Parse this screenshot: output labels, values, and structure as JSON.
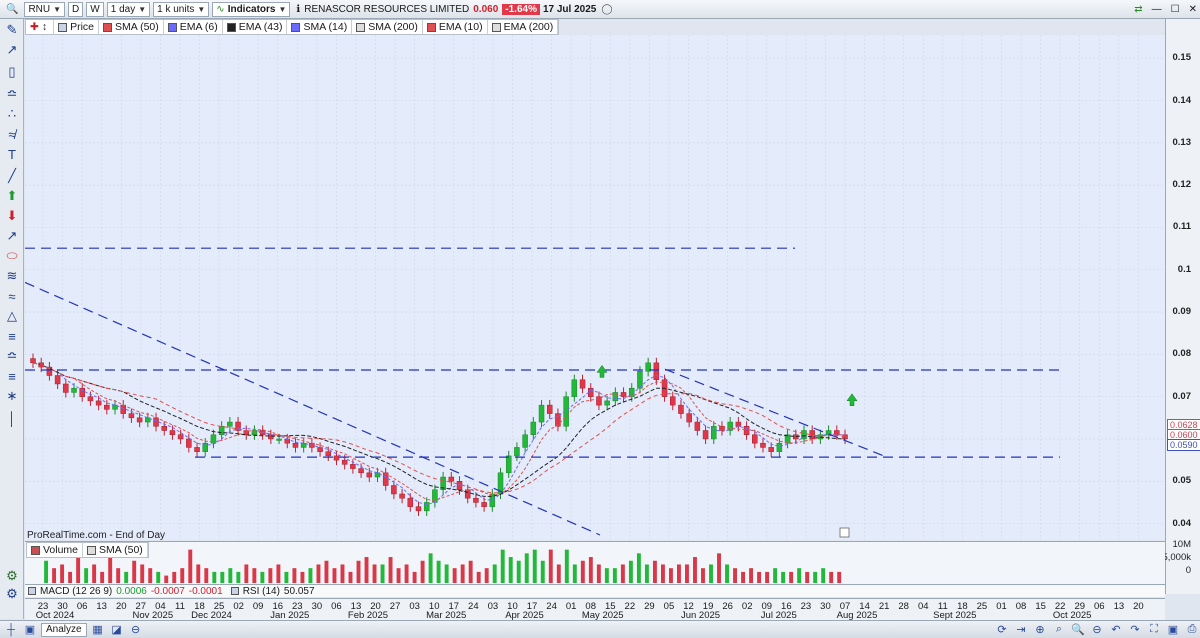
{
  "toolbar": {
    "symbol": "RNU",
    "d_btn": "D",
    "w_btn": "W",
    "period": "1 day",
    "units": "1 k units",
    "indicators": "Indicators",
    "instrument": "RENASCOR RESOURCES LIMITED",
    "last_price": "0.060",
    "change": "-1.64%",
    "date": "17 Jul 2025"
  },
  "legend": [
    {
      "label": "Price",
      "color": "#c8d4e6"
    },
    {
      "label": "SMA (50)",
      "color": "#e05050"
    },
    {
      "label": "EMA (6)",
      "color": "#6a6aff"
    },
    {
      "label": "EMA (43)",
      "color": "#222222"
    },
    {
      "label": "SMA (14)",
      "color": "#6a6aff"
    },
    {
      "label": "SMA (200)",
      "color": "#dddddd"
    },
    {
      "label": "EMA (10)",
      "color": "#e05050"
    },
    {
      "label": "EMA (200)",
      "color": "#dddddd"
    }
  ],
  "footnote": "ProRealTime.com - End of Day",
  "volume_legend": [
    {
      "label": "Volume",
      "color": "#c85050"
    },
    {
      "label": "SMA (50)",
      "color": "#dddddd"
    }
  ],
  "volume_axis": [
    "10M",
    "5,000k",
    "0"
  ],
  "macd": {
    "label": "MACD (12 26 9)",
    "v1": "0.0006",
    "v2": "-0.0007",
    "v3": "-0.0001",
    "rsi_label": "RSI (14)",
    "rsi_value": "50.057"
  },
  "price_tags": [
    "0.0628",
    "0.0600",
    "0.0590"
  ],
  "bottom": {
    "analyze": "Analyze"
  },
  "chart_data": {
    "type": "candlestick",
    "title": "RENASCOR RESOURCES LIMITED",
    "y_ticks": [
      "0.15",
      "0.14",
      "0.13",
      "0.12",
      "0.11",
      "0.1",
      "0.09",
      "0.08",
      "0.07",
      "0.06",
      "0.05",
      "0.04"
    ],
    "ylim": [
      0.0373,
      0.1536
    ],
    "x_day_labels": [
      "23",
      "30",
      "06",
      "13",
      "20",
      "27",
      "04",
      "11",
      "18",
      "25",
      "02",
      "09",
      "16",
      "23",
      "30",
      "06",
      "13",
      "20",
      "27",
      "03",
      "10",
      "17",
      "24",
      "03",
      "10",
      "17",
      "24",
      "01",
      "08",
      "15",
      "22",
      "29",
      "05",
      "12",
      "19",
      "26",
      "02",
      "09",
      "16",
      "23",
      "30",
      "07",
      "14",
      "21",
      "28",
      "04",
      "11",
      "18",
      "25",
      "01",
      "08",
      "15",
      "22",
      "29",
      "06",
      "13",
      "20"
    ],
    "x_month_labels": [
      "Oct 2024",
      "Nov 2025",
      "Dec 2024",
      "Jan 2025",
      "Feb 2025",
      "Mar 2025",
      "Apr 2025",
      "May 2025",
      "Jun 2025",
      "Jul 2025",
      "Aug 2025",
      "Sept 2025",
      "Oct 2025"
    ],
    "close_path": [
      0.078,
      0.077,
      0.075,
      0.073,
      0.071,
      0.072,
      0.07,
      0.069,
      0.068,
      0.067,
      0.068,
      0.066,
      0.065,
      0.064,
      0.065,
      0.063,
      0.062,
      0.061,
      0.06,
      0.058,
      0.057,
      0.059,
      0.061,
      0.063,
      0.064,
      0.062,
      0.061,
      0.062,
      0.061,
      0.06,
      0.06,
      0.059,
      0.058,
      0.059,
      0.058,
      0.057,
      0.056,
      0.055,
      0.054,
      0.053,
      0.052,
      0.051,
      0.052,
      0.049,
      0.047,
      0.046,
      0.044,
      0.043,
      0.045,
      0.048,
      0.051,
      0.05,
      0.048,
      0.046,
      0.045,
      0.044,
      0.047,
      0.052,
      0.056,
      0.058,
      0.061,
      0.064,
      0.068,
      0.066,
      0.063,
      0.07,
      0.074,
      0.072,
      0.07,
      0.068,
      0.069,
      0.071,
      0.07,
      0.072,
      0.076,
      0.078,
      0.074,
      0.07,
      0.068,
      0.066,
      0.064,
      0.062,
      0.06,
      0.063,
      0.062,
      0.064,
      0.063,
      0.061,
      0.059,
      0.058,
      0.057,
      0.059,
      0.061,
      0.06,
      0.062,
      0.06,
      0.061,
      0.062,
      0.061,
      0.06
    ],
    "volume_relative": [
      0.6,
      0.4,
      0.5,
      0.3,
      0.7,
      0.4,
      0.5,
      0.3,
      0.9,
      0.4,
      0.3,
      0.6,
      0.5,
      0.4,
      0.3,
      0.2,
      0.3,
      0.4,
      0.9,
      0.5,
      0.4,
      0.3,
      0.3,
      0.4,
      0.3,
      0.5,
      0.4,
      0.3,
      0.4,
      0.5,
      0.3,
      0.4,
      0.3,
      0.4,
      0.5,
      0.6,
      0.4,
      0.5,
      0.3,
      0.6,
      0.7,
      0.5,
      0.5,
      0.7,
      0.4,
      0.5,
      0.3,
      0.6,
      0.8,
      0.6,
      0.5,
      0.4,
      0.5,
      0.6,
      0.3,
      0.4,
      0.5,
      0.9,
      0.7,
      0.6,
      0.8,
      0.9,
      0.6,
      0.9,
      0.5,
      0.9,
      0.5,
      0.6,
      0.7,
      0.5,
      0.4,
      0.4,
      0.5,
      0.6,
      0.8,
      0.5,
      0.6,
      0.5,
      0.4,
      0.5,
      0.5,
      0.7,
      0.4,
      0.5,
      0.8,
      0.5,
      0.4,
      0.3,
      0.4,
      0.3,
      0.3,
      0.4,
      0.3,
      0.3,
      0.4,
      0.3,
      0.3,
      0.4,
      0.3,
      0.3
    ],
    "horizontal_lines": [
      0.1051,
      0.0763,
      0.0557
    ],
    "trendlines": [
      {
        "from": [
          "Oct 2024",
          0.097
        ],
        "to": [
          "Apr 2025",
          0.0373
        ]
      },
      {
        "from": [
          "May 2025",
          0.0765
        ],
        "to": [
          "Jul 2025",
          0.0557
        ]
      }
    ],
    "grid": true
  }
}
